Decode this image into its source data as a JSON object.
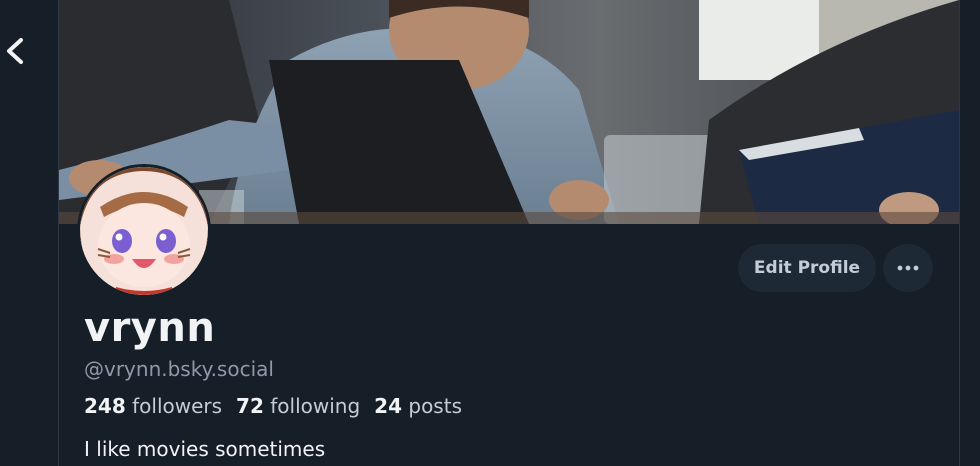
{
  "profile": {
    "display_name": "vrynn",
    "handle": "@vrynn.bsky.social",
    "bio": "I like movies sometimes"
  },
  "actions": {
    "edit_label": "Edit Profile",
    "more_icon": "ellipsis-horizontal-icon"
  },
  "stats": {
    "followers_count": "248",
    "followers_label": "followers",
    "following_count": "72",
    "following_label": "following",
    "posts_count": "24",
    "posts_label": "posts"
  },
  "icons": {
    "back": "chevron-left-icon"
  },
  "colors": {
    "background": "#161e27",
    "button_bg": "#1e2936",
    "muted_text": "#8d9aa9",
    "primary_text": "#f1f3f5"
  }
}
